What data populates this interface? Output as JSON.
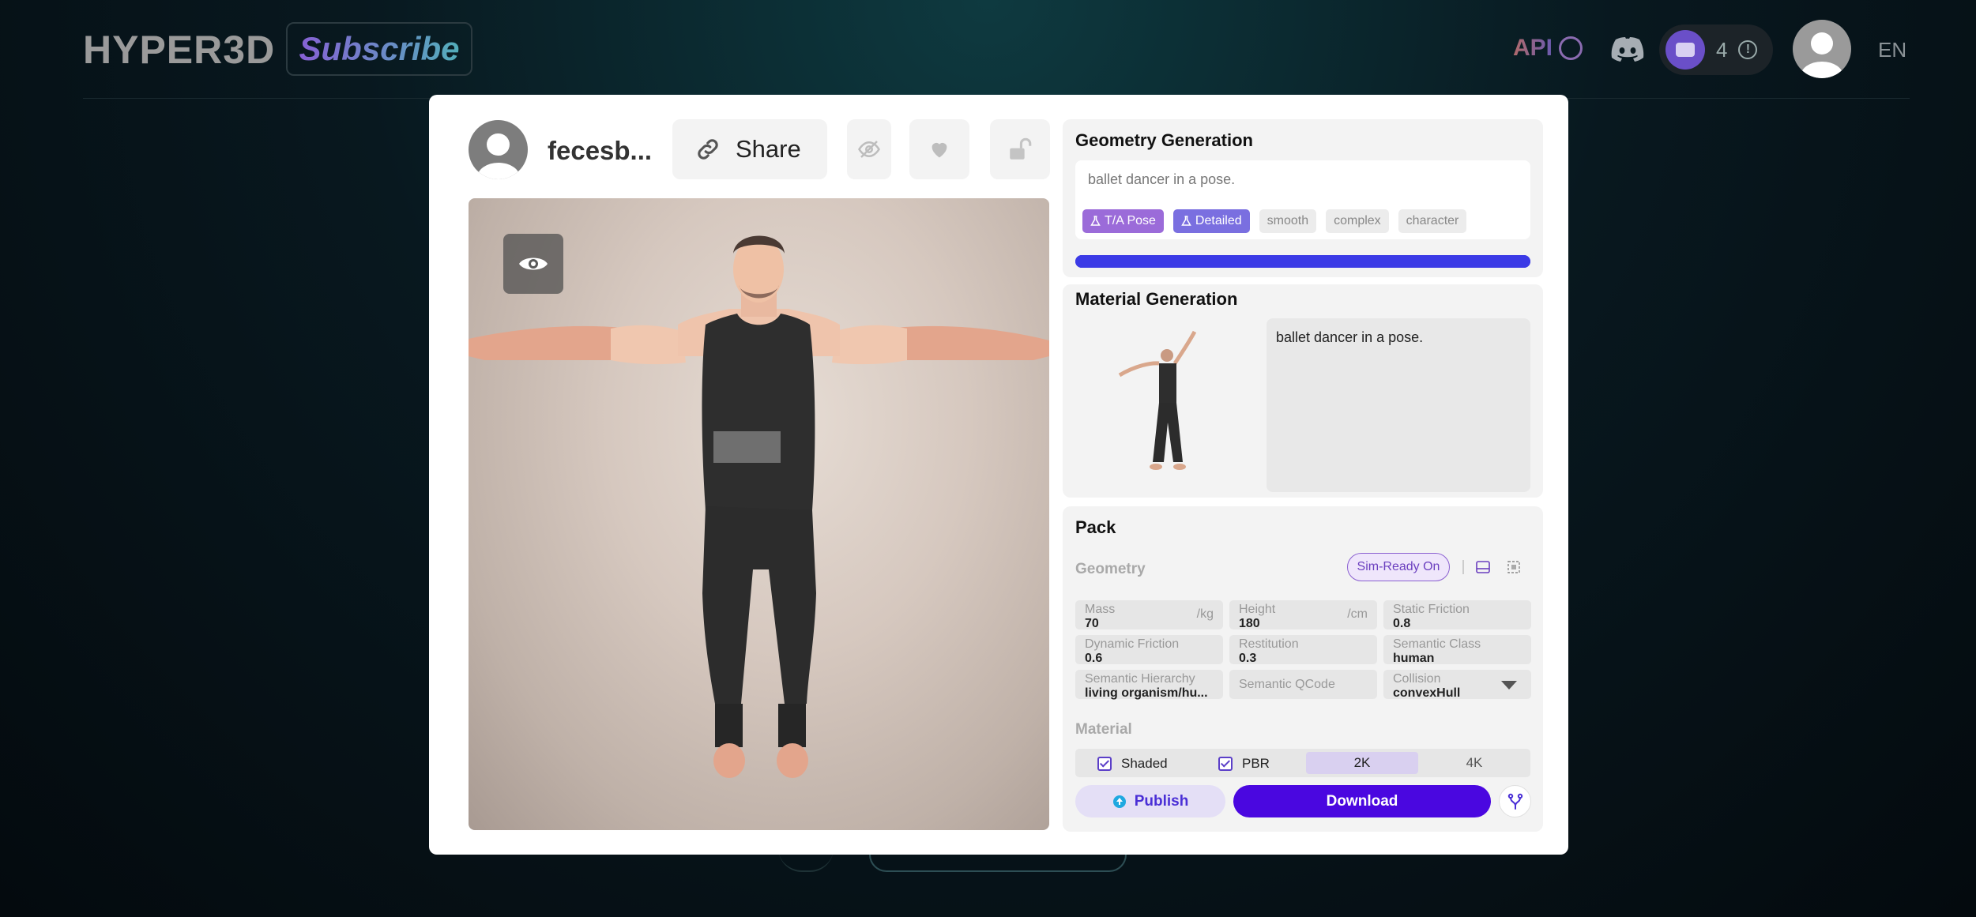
{
  "nav": {
    "logo": "HYPER3D",
    "subscribe_label": "Subscribe",
    "api_label": "API",
    "credits": "4",
    "language": "EN"
  },
  "header": {
    "author_name": "fecesb...",
    "share_label": "Share"
  },
  "geometry": {
    "title": "Geometry Generation",
    "prompt": "ballet dancer in a pose.",
    "tags": [
      {
        "label": "T/A Pose",
        "active": true
      },
      {
        "label": "Detailed",
        "active": true
      },
      {
        "label": "smooth",
        "active": false
      },
      {
        "label": "complex",
        "active": false
      },
      {
        "label": "character",
        "active": false
      }
    ],
    "progress": 1.0
  },
  "material_generation": {
    "title": "Material Generation",
    "prompt": "ballet dancer in a pose."
  },
  "pack": {
    "title": "Pack",
    "geometry_label": "Geometry",
    "sim_ready_label": "Sim-Ready On",
    "fields": {
      "mass": {
        "label": "Mass",
        "value": "70",
        "unit": "/kg"
      },
      "height": {
        "label": "Height",
        "value": "180",
        "unit": "/cm"
      },
      "static_friction": {
        "label": "Static Friction",
        "value": "0.8"
      },
      "dynamic_friction": {
        "label": "Dynamic Friction",
        "value": "0.6"
      },
      "restitution": {
        "label": "Restitution",
        "value": "0.3"
      },
      "semantic_class": {
        "label": "Semantic Class",
        "value": "human"
      },
      "semantic_hierarchy": {
        "label": "Semantic Hierarchy",
        "value": "living organism/hu..."
      },
      "semantic_qcode": {
        "label": "Semantic QCode"
      },
      "collision": {
        "label": "Collision",
        "value": "convexHull"
      }
    },
    "material_label": "Material",
    "shaded_label": "Shaded",
    "pbr_label": "PBR",
    "res_2k": "2K",
    "res_4k": "4K",
    "selected_resolution": "2K"
  },
  "actions": {
    "publish_label": "Publish",
    "download_label": "Download"
  },
  "colors": {
    "accent": "#4a07e0",
    "progress": "#3b3ae6",
    "sim_ready": "#8a5fd0"
  },
  "icons": [
    "discord-icon",
    "wallet-icon",
    "info-icon",
    "link-icon",
    "eye-off-icon",
    "heart-icon",
    "unlock-icon",
    "eye-icon",
    "flask-icon",
    "cube-icon",
    "bbox-icon",
    "publish-icon",
    "fork-icon"
  ]
}
